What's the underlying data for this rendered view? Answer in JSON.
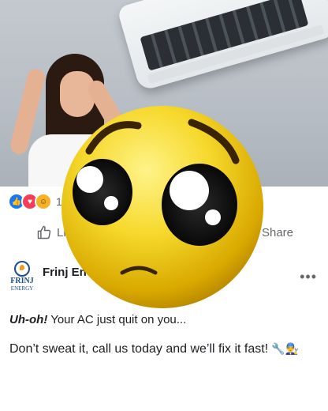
{
  "reactions": {
    "count": "1"
  },
  "actions": {
    "like_label": "Li",
    "share_label": "Share"
  },
  "page": {
    "logo_text": "FRINJ",
    "logo_sub": "ENERGY",
    "name": "Frinj Ene"
  },
  "post": {
    "line1_bold": "Uh-oh!",
    "line1_rest": " Your AC just quit on you...",
    "line2": "Don’t sweat it, call us today and we’ll fix it fast!",
    "line2_emoji": "🔧👨‍🔧"
  },
  "colors": {
    "like_blue": "#1877f2",
    "love_red": "#f33e58",
    "haha_yellow": "#f7b125",
    "muted_text": "#65676b",
    "logo_blue": "#1f4e8c",
    "logo_orange": "#f29a1f"
  },
  "icons": [
    "like-reaction-icon",
    "love-reaction-icon",
    "haha-reaction-icon",
    "thumbs-up-icon",
    "more-options-icon",
    "pleading-face-emoji"
  ]
}
